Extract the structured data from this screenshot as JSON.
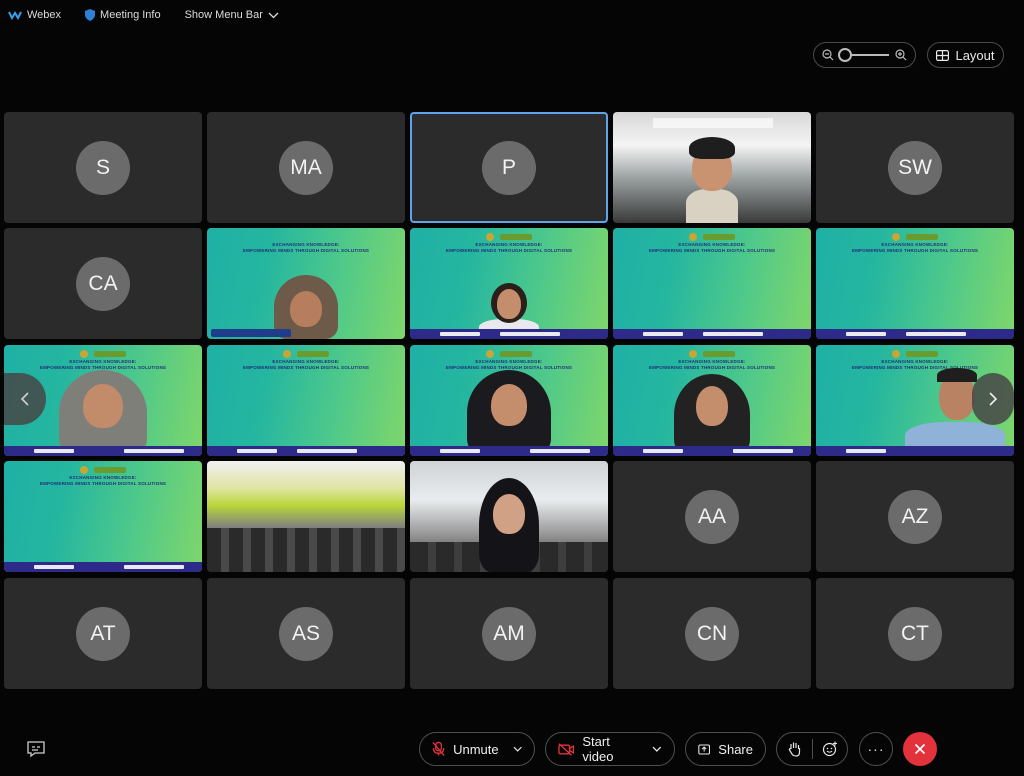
{
  "titlebar": {
    "app_name": "Webex",
    "meeting_info": "Meeting Info",
    "show_menu_bar": "Show Menu Bar"
  },
  "top_controls": {
    "layout_label": "Layout",
    "zoom_level": 0
  },
  "slide": {
    "title_line1": "EXCHANGING KNOWLEDGE:",
    "title_line2": "EMPOWERING MINDS THROUGH DIGITAL SOLUTIONS"
  },
  "participants": [
    {
      "initials": "S",
      "type": "avatar"
    },
    {
      "initials": "MA",
      "type": "avatar"
    },
    {
      "initials": "P",
      "type": "avatar",
      "active": true
    },
    {
      "initials": "",
      "type": "video"
    },
    {
      "initials": "SW",
      "type": "avatar"
    },
    {
      "initials": "CA",
      "type": "avatar"
    },
    {
      "initials": "",
      "type": "video"
    },
    {
      "initials": "",
      "type": "video"
    },
    {
      "initials": "",
      "type": "video"
    },
    {
      "initials": "",
      "type": "video"
    },
    {
      "initials": "",
      "type": "video"
    },
    {
      "initials": "",
      "type": "video"
    },
    {
      "initials": "",
      "type": "video"
    },
    {
      "initials": "",
      "type": "video"
    },
    {
      "initials": "",
      "type": "video"
    },
    {
      "initials": "",
      "type": "video"
    },
    {
      "initials": "",
      "type": "video"
    },
    {
      "initials": "",
      "type": "video"
    },
    {
      "initials": "AA",
      "type": "avatar"
    },
    {
      "initials": "AZ",
      "type": "avatar"
    },
    {
      "initials": "AT",
      "type": "avatar"
    },
    {
      "initials": "AS",
      "type": "avatar"
    },
    {
      "initials": "AM",
      "type": "avatar"
    },
    {
      "initials": "CN",
      "type": "avatar"
    },
    {
      "initials": "CT",
      "type": "avatar"
    }
  ],
  "bottombar": {
    "unmute_label": "Unmute",
    "start_video_label": "Start video",
    "share_label": "Share",
    "more_label": "···"
  },
  "colors": {
    "background": "#050505",
    "tile": "#2b2b2b",
    "avatar": "#6b6b6b",
    "active_border": "#5ea4e8",
    "end_call": "#e2333d",
    "muted_icon": "#e2333d"
  }
}
